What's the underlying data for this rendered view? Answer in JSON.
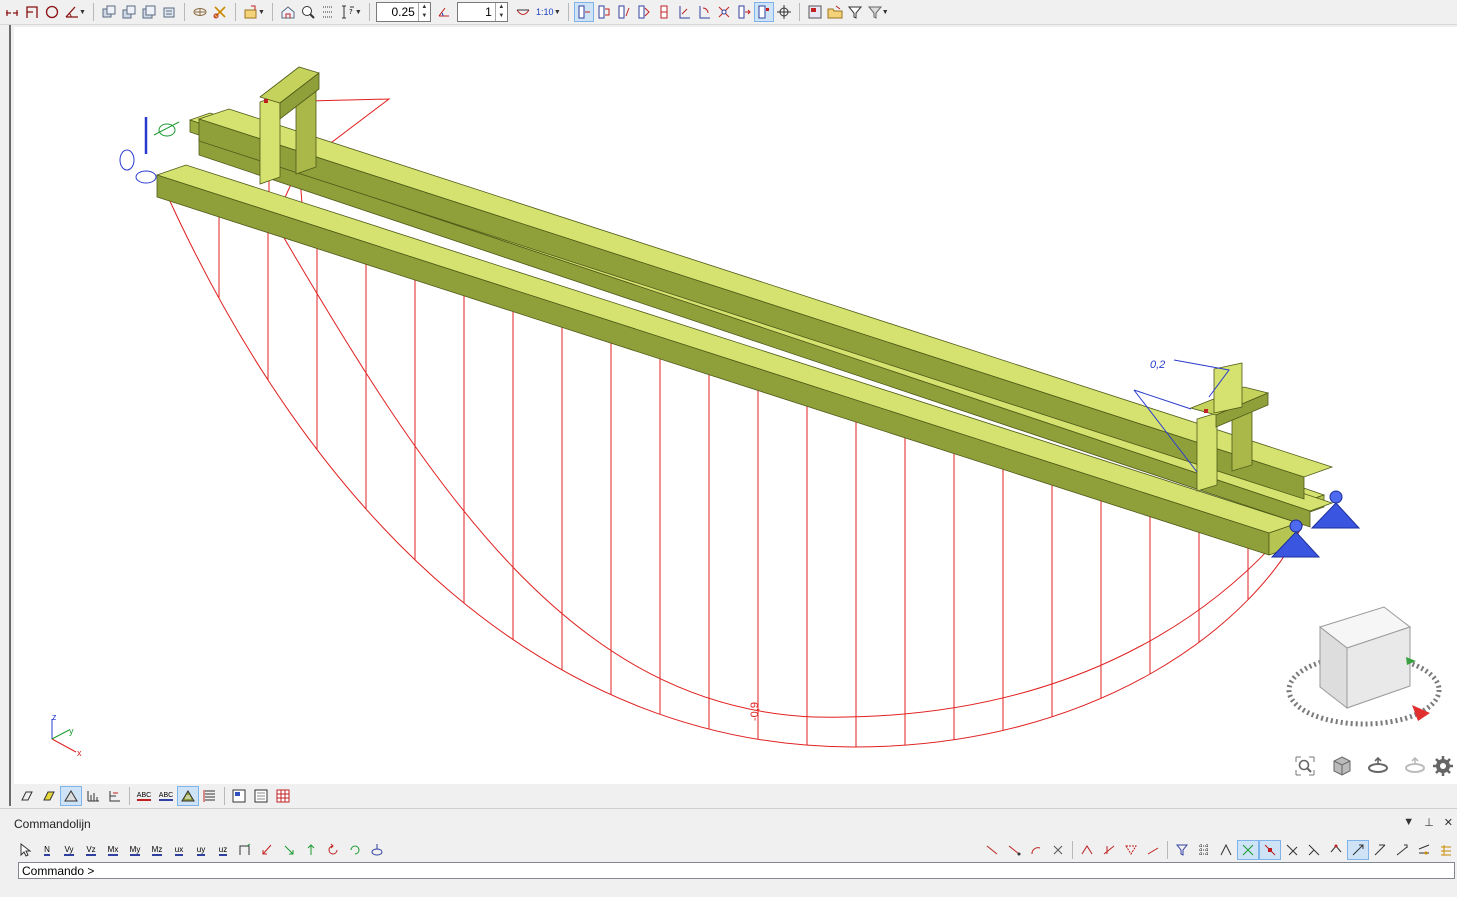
{
  "toolbar": {
    "scale_value": "0.25",
    "step_value": "1",
    "ratio_label": "1:10"
  },
  "viewport": {
    "annotations": {
      "max_moment": "-0,9",
      "end_value": "0,2"
    },
    "axis_triad": {
      "z": "z",
      "y": "y",
      "x": "x"
    }
  },
  "bottom_toolbar": {
    "abc_label_1": "ABC",
    "abc_label_2": "ABC"
  },
  "command_panel": {
    "title": "Commandolijn",
    "prompt": "Commando >",
    "input_value": "",
    "tools": {
      "N": "N",
      "Vy": "Vy",
      "Vz": "Vz",
      "Mx": "Mx",
      "My": "My",
      "Mz": "Mz",
      "ux": "ux",
      "uy": "uy",
      "uz": "uz"
    }
  },
  "colors": {
    "beam_top": "#d5e26f",
    "beam_side": "#8fa03a",
    "diagram": "#e02020",
    "support": "#3a55e0",
    "annotation": "#2a3ccf"
  }
}
